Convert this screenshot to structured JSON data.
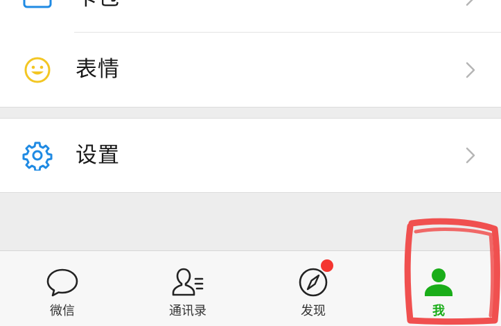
{
  "menu": {
    "top_item_label": "卡包",
    "items": [
      {
        "label": "表情",
        "icon": "smiley-icon"
      },
      {
        "label": "设置",
        "icon": "gear-icon"
      }
    ]
  },
  "tabbar": {
    "tabs": [
      {
        "label": "微信",
        "icon": "chat-bubble-icon",
        "active": false
      },
      {
        "label": "通讯录",
        "icon": "contacts-icon",
        "active": false
      },
      {
        "label": "发现",
        "icon": "compass-icon",
        "active": false,
        "badge": true
      },
      {
        "label": "我",
        "icon": "person-icon",
        "active": true
      }
    ]
  },
  "colors": {
    "accent_green": "#1aad19",
    "badge_red": "#f43530",
    "icon_blue": "#1f8ae3",
    "icon_yellow": "#f3c623",
    "annotation_red": "#f0504f"
  }
}
